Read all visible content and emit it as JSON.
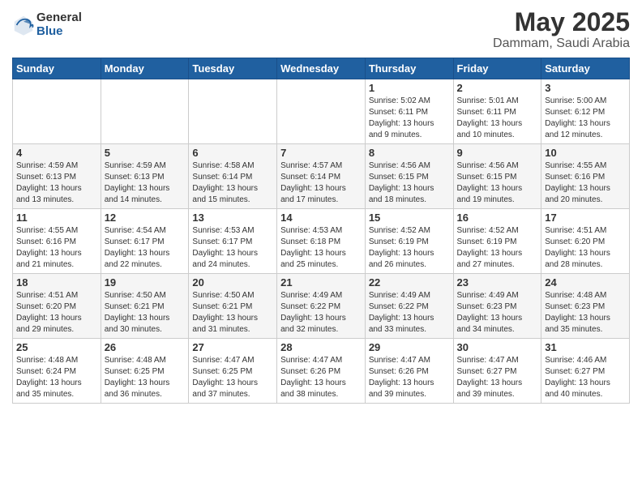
{
  "header": {
    "logo_general": "General",
    "logo_blue": "Blue",
    "title": "May 2025",
    "subtitle": "Dammam, Saudi Arabia"
  },
  "days_of_week": [
    "Sunday",
    "Monday",
    "Tuesday",
    "Wednesday",
    "Thursday",
    "Friday",
    "Saturday"
  ],
  "weeks": [
    [
      {
        "day": "",
        "info": ""
      },
      {
        "day": "",
        "info": ""
      },
      {
        "day": "",
        "info": ""
      },
      {
        "day": "",
        "info": ""
      },
      {
        "day": "1",
        "info": "Sunrise: 5:02 AM\nSunset: 6:11 PM\nDaylight: 13 hours\nand 9 minutes."
      },
      {
        "day": "2",
        "info": "Sunrise: 5:01 AM\nSunset: 6:11 PM\nDaylight: 13 hours\nand 10 minutes."
      },
      {
        "day": "3",
        "info": "Sunrise: 5:00 AM\nSunset: 6:12 PM\nDaylight: 13 hours\nand 12 minutes."
      }
    ],
    [
      {
        "day": "4",
        "info": "Sunrise: 4:59 AM\nSunset: 6:13 PM\nDaylight: 13 hours\nand 13 minutes."
      },
      {
        "day": "5",
        "info": "Sunrise: 4:59 AM\nSunset: 6:13 PM\nDaylight: 13 hours\nand 14 minutes."
      },
      {
        "day": "6",
        "info": "Sunrise: 4:58 AM\nSunset: 6:14 PM\nDaylight: 13 hours\nand 15 minutes."
      },
      {
        "day": "7",
        "info": "Sunrise: 4:57 AM\nSunset: 6:14 PM\nDaylight: 13 hours\nand 17 minutes."
      },
      {
        "day": "8",
        "info": "Sunrise: 4:56 AM\nSunset: 6:15 PM\nDaylight: 13 hours\nand 18 minutes."
      },
      {
        "day": "9",
        "info": "Sunrise: 4:56 AM\nSunset: 6:15 PM\nDaylight: 13 hours\nand 19 minutes."
      },
      {
        "day": "10",
        "info": "Sunrise: 4:55 AM\nSunset: 6:16 PM\nDaylight: 13 hours\nand 20 minutes."
      }
    ],
    [
      {
        "day": "11",
        "info": "Sunrise: 4:55 AM\nSunset: 6:16 PM\nDaylight: 13 hours\nand 21 minutes."
      },
      {
        "day": "12",
        "info": "Sunrise: 4:54 AM\nSunset: 6:17 PM\nDaylight: 13 hours\nand 22 minutes."
      },
      {
        "day": "13",
        "info": "Sunrise: 4:53 AM\nSunset: 6:17 PM\nDaylight: 13 hours\nand 24 minutes."
      },
      {
        "day": "14",
        "info": "Sunrise: 4:53 AM\nSunset: 6:18 PM\nDaylight: 13 hours\nand 25 minutes."
      },
      {
        "day": "15",
        "info": "Sunrise: 4:52 AM\nSunset: 6:19 PM\nDaylight: 13 hours\nand 26 minutes."
      },
      {
        "day": "16",
        "info": "Sunrise: 4:52 AM\nSunset: 6:19 PM\nDaylight: 13 hours\nand 27 minutes."
      },
      {
        "day": "17",
        "info": "Sunrise: 4:51 AM\nSunset: 6:20 PM\nDaylight: 13 hours\nand 28 minutes."
      }
    ],
    [
      {
        "day": "18",
        "info": "Sunrise: 4:51 AM\nSunset: 6:20 PM\nDaylight: 13 hours\nand 29 minutes."
      },
      {
        "day": "19",
        "info": "Sunrise: 4:50 AM\nSunset: 6:21 PM\nDaylight: 13 hours\nand 30 minutes."
      },
      {
        "day": "20",
        "info": "Sunrise: 4:50 AM\nSunset: 6:21 PM\nDaylight: 13 hours\nand 31 minutes."
      },
      {
        "day": "21",
        "info": "Sunrise: 4:49 AM\nSunset: 6:22 PM\nDaylight: 13 hours\nand 32 minutes."
      },
      {
        "day": "22",
        "info": "Sunrise: 4:49 AM\nSunset: 6:22 PM\nDaylight: 13 hours\nand 33 minutes."
      },
      {
        "day": "23",
        "info": "Sunrise: 4:49 AM\nSunset: 6:23 PM\nDaylight: 13 hours\nand 34 minutes."
      },
      {
        "day": "24",
        "info": "Sunrise: 4:48 AM\nSunset: 6:23 PM\nDaylight: 13 hours\nand 35 minutes."
      }
    ],
    [
      {
        "day": "25",
        "info": "Sunrise: 4:48 AM\nSunset: 6:24 PM\nDaylight: 13 hours\nand 35 minutes."
      },
      {
        "day": "26",
        "info": "Sunrise: 4:48 AM\nSunset: 6:25 PM\nDaylight: 13 hours\nand 36 minutes."
      },
      {
        "day": "27",
        "info": "Sunrise: 4:47 AM\nSunset: 6:25 PM\nDaylight: 13 hours\nand 37 minutes."
      },
      {
        "day": "28",
        "info": "Sunrise: 4:47 AM\nSunset: 6:26 PM\nDaylight: 13 hours\nand 38 minutes."
      },
      {
        "day": "29",
        "info": "Sunrise: 4:47 AM\nSunset: 6:26 PM\nDaylight: 13 hours\nand 39 minutes."
      },
      {
        "day": "30",
        "info": "Sunrise: 4:47 AM\nSunset: 6:27 PM\nDaylight: 13 hours\nand 39 minutes."
      },
      {
        "day": "31",
        "info": "Sunrise: 4:46 AM\nSunset: 6:27 PM\nDaylight: 13 hours\nand 40 minutes."
      }
    ]
  ]
}
